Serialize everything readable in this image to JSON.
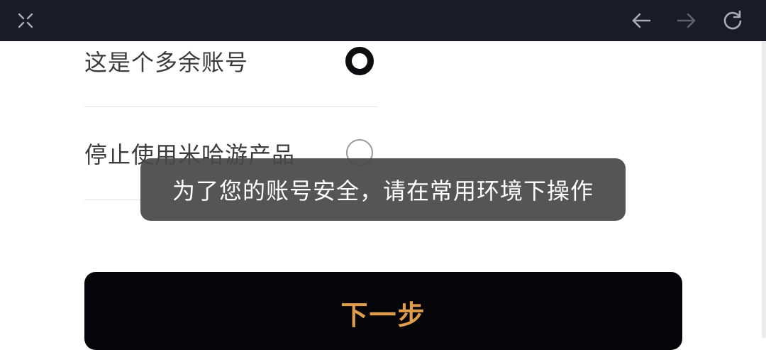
{
  "top_bar": {
    "background": "#1a1b25",
    "icons": [
      "close-icon",
      "back-arrow-icon",
      "forward-arrow-icon",
      "refresh-icon"
    ]
  },
  "reasons": [
    {
      "label": "这是个多余账号",
      "selected": true
    },
    {
      "label": "停止使用米哈游产品",
      "selected": false
    }
  ],
  "toast": {
    "message": "为了您的账号安全，请在常用环境下操作"
  },
  "next_button": {
    "label": "下一步",
    "text_color": "#e09e4c"
  }
}
